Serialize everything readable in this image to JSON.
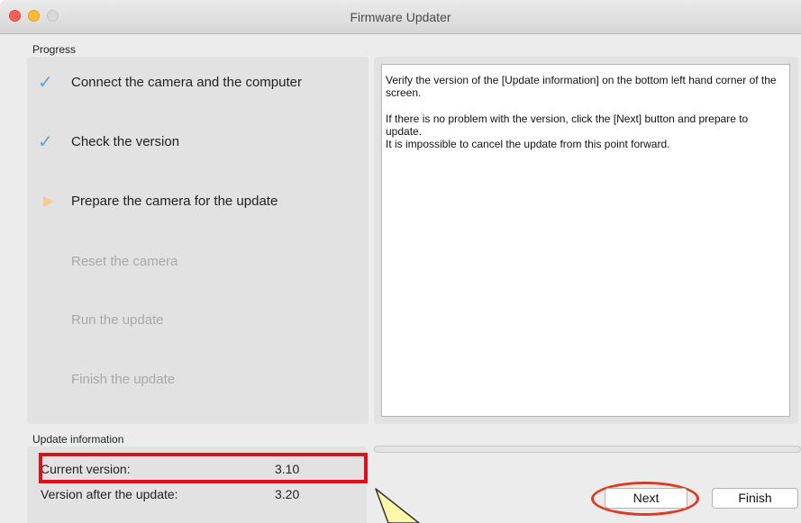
{
  "window": {
    "title": "Firmware Updater"
  },
  "progress": {
    "label": "Progress",
    "steps": [
      {
        "label": "Connect the camera and the computer",
        "state": "done",
        "icon": "checkmark-icon"
      },
      {
        "label": "Check the version",
        "state": "done",
        "icon": "checkmark-icon"
      },
      {
        "label": "Prepare the camera for the update",
        "state": "current",
        "icon": "current-step-arrow-icon"
      },
      {
        "label": "Reset the camera",
        "state": "pending"
      },
      {
        "label": "Run the update",
        "state": "pending"
      },
      {
        "label": "Finish the update",
        "state": "pending"
      }
    ]
  },
  "info": {
    "paragraph1": "Verify the version of the [Update information] on the bottom left hand corner of the screen.",
    "paragraph2": "If there is no problem with the version, click the [Next] button and prepare to update.",
    "paragraph3": "It is impossible to cancel the update from this point forward."
  },
  "update_info": {
    "label": "Update information",
    "current_label": "Current version:",
    "current_value": "3.10",
    "after_label": "Version after the update:",
    "after_value": "3.20"
  },
  "buttons": {
    "next": "Next",
    "finish": "Finish"
  },
  "colors": {
    "check": "#5fa3cf",
    "current_arrow": "#f6c98f",
    "highlight": "#e0101b",
    "next_oval": "#dd3a1f",
    "callout": "#fdf7a8"
  }
}
